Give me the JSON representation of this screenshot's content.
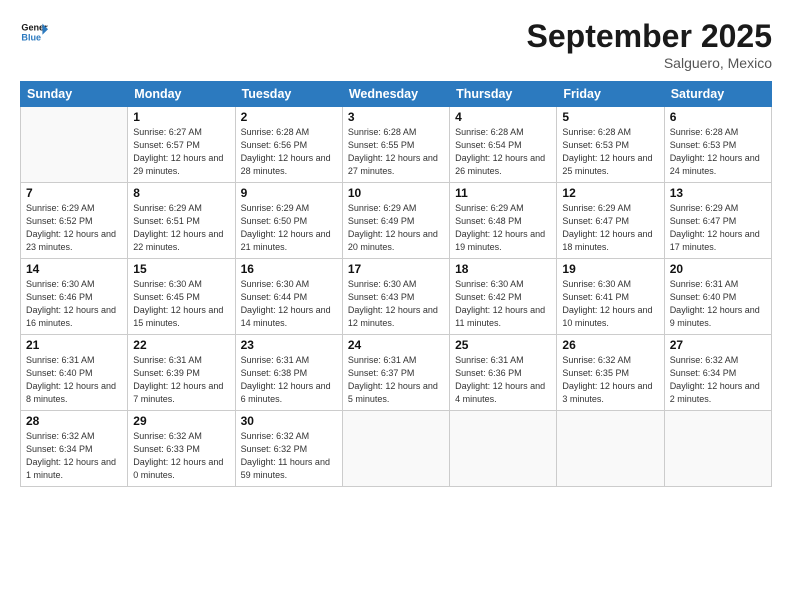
{
  "header": {
    "logo_line1": "General",
    "logo_line2": "Blue",
    "month": "September 2025",
    "location": "Salguero, Mexico"
  },
  "weekdays": [
    "Sunday",
    "Monday",
    "Tuesday",
    "Wednesday",
    "Thursday",
    "Friday",
    "Saturday"
  ],
  "weeks": [
    [
      {
        "day": "",
        "detail": ""
      },
      {
        "day": "1",
        "detail": "Sunrise: 6:27 AM\nSunset: 6:57 PM\nDaylight: 12 hours\nand 29 minutes."
      },
      {
        "day": "2",
        "detail": "Sunrise: 6:28 AM\nSunset: 6:56 PM\nDaylight: 12 hours\nand 28 minutes."
      },
      {
        "day": "3",
        "detail": "Sunrise: 6:28 AM\nSunset: 6:55 PM\nDaylight: 12 hours\nand 27 minutes."
      },
      {
        "day": "4",
        "detail": "Sunrise: 6:28 AM\nSunset: 6:54 PM\nDaylight: 12 hours\nand 26 minutes."
      },
      {
        "day": "5",
        "detail": "Sunrise: 6:28 AM\nSunset: 6:53 PM\nDaylight: 12 hours\nand 25 minutes."
      },
      {
        "day": "6",
        "detail": "Sunrise: 6:28 AM\nSunset: 6:53 PM\nDaylight: 12 hours\nand 24 minutes."
      }
    ],
    [
      {
        "day": "7",
        "detail": "Sunrise: 6:29 AM\nSunset: 6:52 PM\nDaylight: 12 hours\nand 23 minutes."
      },
      {
        "day": "8",
        "detail": "Sunrise: 6:29 AM\nSunset: 6:51 PM\nDaylight: 12 hours\nand 22 minutes."
      },
      {
        "day": "9",
        "detail": "Sunrise: 6:29 AM\nSunset: 6:50 PM\nDaylight: 12 hours\nand 21 minutes."
      },
      {
        "day": "10",
        "detail": "Sunrise: 6:29 AM\nSunset: 6:49 PM\nDaylight: 12 hours\nand 20 minutes."
      },
      {
        "day": "11",
        "detail": "Sunrise: 6:29 AM\nSunset: 6:48 PM\nDaylight: 12 hours\nand 19 minutes."
      },
      {
        "day": "12",
        "detail": "Sunrise: 6:29 AM\nSunset: 6:47 PM\nDaylight: 12 hours\nand 18 minutes."
      },
      {
        "day": "13",
        "detail": "Sunrise: 6:29 AM\nSunset: 6:47 PM\nDaylight: 12 hours\nand 17 minutes."
      }
    ],
    [
      {
        "day": "14",
        "detail": "Sunrise: 6:30 AM\nSunset: 6:46 PM\nDaylight: 12 hours\nand 16 minutes."
      },
      {
        "day": "15",
        "detail": "Sunrise: 6:30 AM\nSunset: 6:45 PM\nDaylight: 12 hours\nand 15 minutes."
      },
      {
        "day": "16",
        "detail": "Sunrise: 6:30 AM\nSunset: 6:44 PM\nDaylight: 12 hours\nand 14 minutes."
      },
      {
        "day": "17",
        "detail": "Sunrise: 6:30 AM\nSunset: 6:43 PM\nDaylight: 12 hours\nand 12 minutes."
      },
      {
        "day": "18",
        "detail": "Sunrise: 6:30 AM\nSunset: 6:42 PM\nDaylight: 12 hours\nand 11 minutes."
      },
      {
        "day": "19",
        "detail": "Sunrise: 6:30 AM\nSunset: 6:41 PM\nDaylight: 12 hours\nand 10 minutes."
      },
      {
        "day": "20",
        "detail": "Sunrise: 6:31 AM\nSunset: 6:40 PM\nDaylight: 12 hours\nand 9 minutes."
      }
    ],
    [
      {
        "day": "21",
        "detail": "Sunrise: 6:31 AM\nSunset: 6:40 PM\nDaylight: 12 hours\nand 8 minutes."
      },
      {
        "day": "22",
        "detail": "Sunrise: 6:31 AM\nSunset: 6:39 PM\nDaylight: 12 hours\nand 7 minutes."
      },
      {
        "day": "23",
        "detail": "Sunrise: 6:31 AM\nSunset: 6:38 PM\nDaylight: 12 hours\nand 6 minutes."
      },
      {
        "day": "24",
        "detail": "Sunrise: 6:31 AM\nSunset: 6:37 PM\nDaylight: 12 hours\nand 5 minutes."
      },
      {
        "day": "25",
        "detail": "Sunrise: 6:31 AM\nSunset: 6:36 PM\nDaylight: 12 hours\nand 4 minutes."
      },
      {
        "day": "26",
        "detail": "Sunrise: 6:32 AM\nSunset: 6:35 PM\nDaylight: 12 hours\nand 3 minutes."
      },
      {
        "day": "27",
        "detail": "Sunrise: 6:32 AM\nSunset: 6:34 PM\nDaylight: 12 hours\nand 2 minutes."
      }
    ],
    [
      {
        "day": "28",
        "detail": "Sunrise: 6:32 AM\nSunset: 6:34 PM\nDaylight: 12 hours\nand 1 minute."
      },
      {
        "day": "29",
        "detail": "Sunrise: 6:32 AM\nSunset: 6:33 PM\nDaylight: 12 hours\nand 0 minutes."
      },
      {
        "day": "30",
        "detail": "Sunrise: 6:32 AM\nSunset: 6:32 PM\nDaylight: 11 hours\nand 59 minutes."
      },
      {
        "day": "",
        "detail": ""
      },
      {
        "day": "",
        "detail": ""
      },
      {
        "day": "",
        "detail": ""
      },
      {
        "day": "",
        "detail": ""
      }
    ]
  ]
}
